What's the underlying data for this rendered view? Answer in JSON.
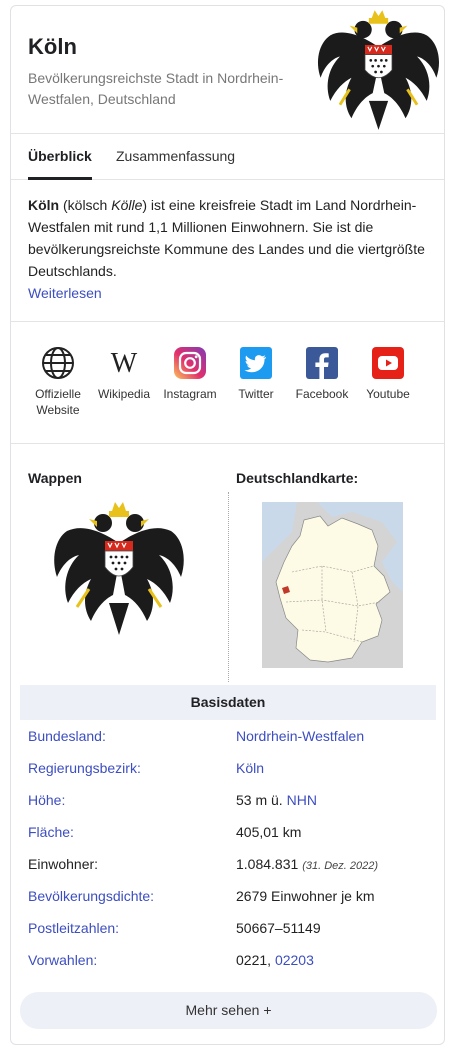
{
  "header": {
    "title": "Köln",
    "subtitle": "Bevölkerungsreichste Stadt in Nordrhein-Westfalen, Deutschland"
  },
  "tabs": [
    {
      "label": "Überblick",
      "active": true
    },
    {
      "label": "Zusammenfassung",
      "active": false
    }
  ],
  "overview": {
    "name": "Köln",
    "paren_open": " (kölsch ",
    "local_name": "Kölle",
    "rest": ") ist eine kreisfreie Stadt im Land Nordrhein-Westfalen mit rund 1,1 Millionen Einwohnern. Sie ist die bevölkerungsreichste Kommune des Landes und die viertgrößte Deutschlands.",
    "read_more": "Weiterlesen"
  },
  "links": [
    {
      "label": "Offizielle Website",
      "icon": "globe-icon"
    },
    {
      "label": "Wikipedia",
      "icon": "wikipedia-icon"
    },
    {
      "label": "Instagram",
      "icon": "instagram-icon"
    },
    {
      "label": "Twitter",
      "icon": "twitter-icon"
    },
    {
      "label": "Facebook",
      "icon": "facebook-icon"
    },
    {
      "label": "Youtube",
      "icon": "youtube-icon"
    }
  ],
  "media": {
    "coat_of_arms_title": "Wappen",
    "map_title": "Deutschlandkarte:"
  },
  "basisdaten": {
    "title": "Basisdaten",
    "rows": [
      {
        "key": "Bundesland:",
        "value": "Nordrhein-Westfalen"
      },
      {
        "key": "Regierungsbezirk:",
        "value": "Köln"
      },
      {
        "key": "Höhe:",
        "value": "53 m ü.",
        "value_link": "NHN"
      },
      {
        "key": "Fläche:",
        "value": "405,01 km"
      },
      {
        "key": "Einwohner:",
        "value": "1.084.831",
        "note": "(31. Dez. 2022)"
      },
      {
        "key": "Bevölkerungsdichte:",
        "value": "2679 Einwohner je km"
      },
      {
        "key": "Postleitzahlen:",
        "value": "50667–51149"
      },
      {
        "key": "Vorwahlen:",
        "value": "0221,",
        "value_link": "02203"
      }
    ]
  },
  "more_button": "Mehr sehen +",
  "colors": {
    "link": "#3c4ec0",
    "basis_background": "#eef0f8",
    "map_highlight": "#c0392b"
  }
}
